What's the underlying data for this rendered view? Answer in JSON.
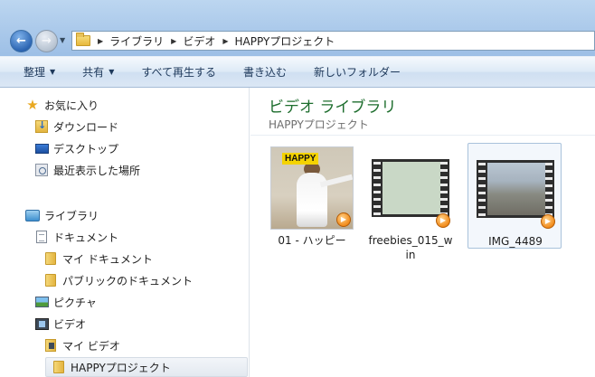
{
  "address": {
    "crumbs": [
      "ライブラリ",
      "ビデオ",
      "HAPPYプロジェクト"
    ]
  },
  "toolbar": {
    "organize": "整理",
    "share": "共有",
    "play_all": "すべて再生する",
    "burn": "書き込む",
    "new_folder": "新しいフォルダー"
  },
  "sidebar": {
    "favorites": "お気に入り",
    "downloads": "ダウンロード",
    "desktop": "デスクトップ",
    "recent": "最近表示した場所",
    "libraries": "ライブラリ",
    "documents": "ドキュメント",
    "my_documents": "マイ ドキュメント",
    "public_documents": "パブリックのドキュメント",
    "pictures": "ピクチャ",
    "videos": "ビデオ",
    "my_videos": "マイ ビデオ",
    "happy_project": "HAPPYプロジェクト"
  },
  "main": {
    "title": "ビデオ ライブラリ",
    "subtitle": "HAPPYプロジェクト",
    "files": [
      {
        "name": "01 - ハッピー",
        "thumb_text": "HAPPY"
      },
      {
        "name": "freebies_015_win"
      },
      {
        "name": "IMG_4489"
      }
    ]
  },
  "colors": {
    "library_title": "#1e6e2e",
    "selection_border": "#a9c2db"
  },
  "icons": {
    "back": "back-arrow-icon",
    "forward": "forward-arrow-icon",
    "play": "play-icon"
  }
}
